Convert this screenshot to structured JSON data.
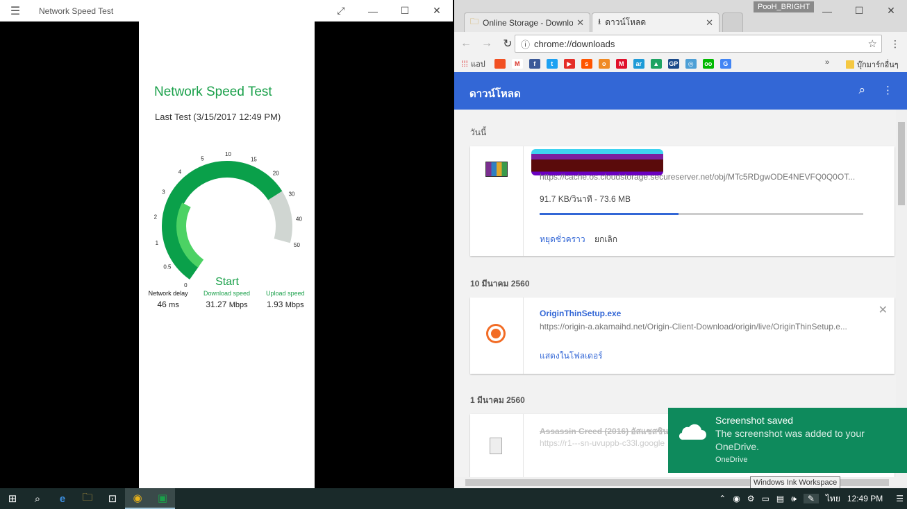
{
  "speed_app": {
    "window_title": "Network Speed Test",
    "heading": "Network Speed Test",
    "last_test": "Last Test (3/15/2017 12:49 PM)",
    "start_label": "Start",
    "gauge_ticks": [
      "0",
      "0.5",
      "1",
      "2",
      "3",
      "4",
      "5",
      "10",
      "15",
      "20",
      "30",
      "40",
      "50"
    ],
    "download_speed_mbps": 31.27,
    "download_fill_fraction": 0.81,
    "upload_fill_fraction": 0.33,
    "colors": {
      "accent": "#1aa04a",
      "dark_fill": "#0aa04a",
      "light_fill": "#4cd264",
      "track": "#d0d6d2"
    },
    "stats": [
      {
        "label": "Network delay",
        "value": "46",
        "unit": "ms",
        "color": "#111111"
      },
      {
        "label": "Download speed",
        "value": "31.27",
        "unit": "Mbps",
        "color": "#1aa04a"
      },
      {
        "label": "Upload speed",
        "value": "1.93",
        "unit": "Mbps",
        "color": "#1aa04a"
      }
    ]
  },
  "chrome": {
    "profile": "PooH_BRIGHT",
    "tabs": [
      {
        "label": "Online Storage - Downlo",
        "icon": "folder-icon"
      },
      {
        "label": "ดาวน์โหลด",
        "icon": "download-icon"
      }
    ],
    "url": "chrome://downloads",
    "bookmarks": {
      "apps_label": "แอป",
      "items": [
        {
          "name": "microsoft",
          "color": "#f25022",
          "glyph": ""
        },
        {
          "name": "gmail",
          "color": "#ffffff",
          "glyph": "M"
        },
        {
          "name": "facebook",
          "color": "#3b5998",
          "glyph": "f"
        },
        {
          "name": "twitter",
          "color": "#1da1f2",
          "glyph": "t"
        },
        {
          "name": "youtube",
          "color": "#e52d27",
          "glyph": "▶"
        },
        {
          "name": "soundcloud",
          "color": "#ff5500",
          "glyph": "s"
        },
        {
          "name": "orange-app",
          "color": "#f08a24",
          "glyph": "o"
        },
        {
          "name": "red-m",
          "color": "#e0102b",
          "glyph": "M"
        },
        {
          "name": "ar-app",
          "color": "#1e9bd7",
          "glyph": "ar"
        },
        {
          "name": "drive",
          "color": "#1ea362",
          "glyph": "▲"
        },
        {
          "name": "gp-app",
          "color": "#1a4a8a",
          "glyph": "GP"
        },
        {
          "name": "earth-app",
          "color": "#4d9fd6",
          "glyph": "◎"
        },
        {
          "name": "line-app",
          "color": "#00b900",
          "glyph": "oo"
        },
        {
          "name": "translate",
          "color": "#4285f4",
          "glyph": "G"
        }
      ],
      "more": "»",
      "other_label": "บุ๊กมาร์กอื่นๆ"
    },
    "downloads": {
      "title": "ดาวน์โหลด",
      "groups": [
        {
          "date": "วันนี้",
          "file_url": "https://cache.os.cloudstorage.secureserver.net/obj/MTc5RDgwODE4NEVFQ0Q0OT...",
          "progress_text": "91.7 KB/วินาที - 73.6 MB",
          "progress_fraction": 0.43,
          "actions": [
            "หยุดชั่วคราว",
            "ยกเลิก"
          ]
        },
        {
          "date": "10 มีนาคม 2560",
          "file_name": "OriginThinSetup.exe",
          "file_url": "https://origin-a.akamaihd.net/Origin-Client-Download/origin/live/OriginThinSetup.e...",
          "action": "แสดงในโฟลเดอร์"
        },
        {
          "date": "1 มีนาคม 2560",
          "file_name": "Assassin Creed (2016) อัสแซสซิน",
          "file_url": "https://r1---sn-uvuppb-c33l.google"
        }
      ]
    }
  },
  "toast": {
    "title": "Screenshot saved",
    "message": "The screenshot was added to your OneDrive.",
    "source": "OneDrive"
  },
  "tooltip": "Windows Ink Workspace",
  "taskbar": {
    "lang": "ไทย",
    "time": "12:49 PM"
  }
}
